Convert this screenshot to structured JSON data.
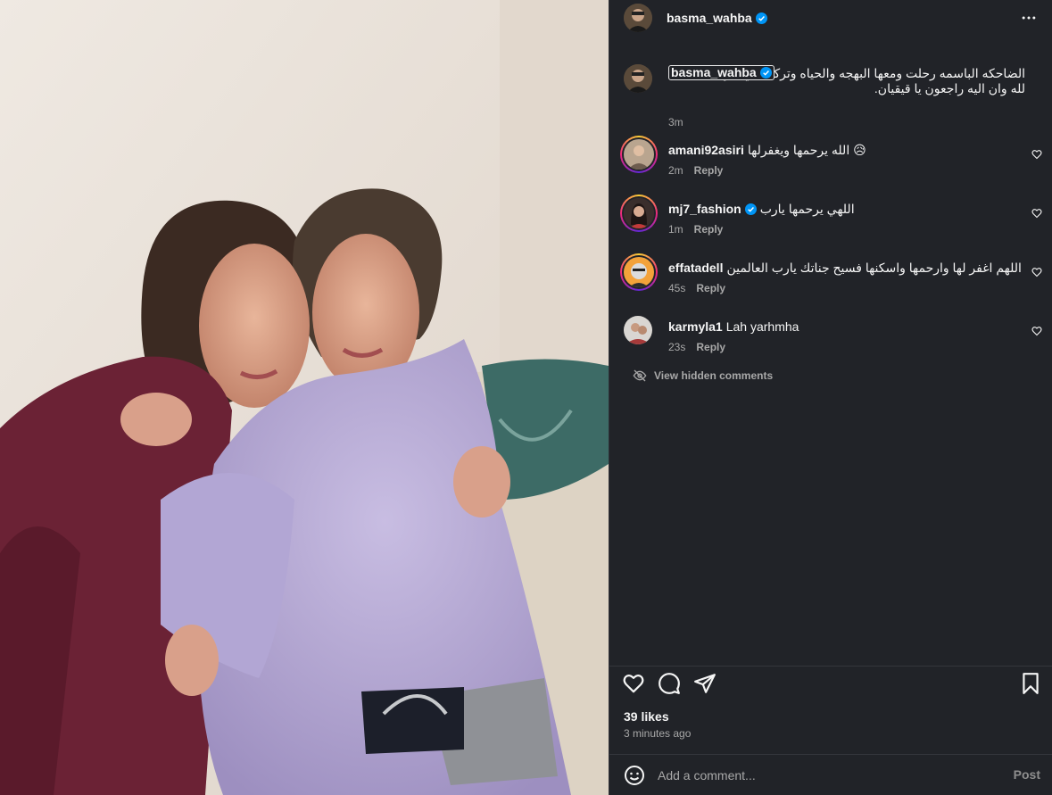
{
  "post": {
    "username": "basma_wahba",
    "verified": true,
    "photo_alt": "Two women hugging on a sofa"
  },
  "caption": {
    "username": "basma_wahba",
    "text": "الضاحكه الباسمه رحلت ومعها البهجه والحياه وتركتنا في دار الشقاء ان لله وان اليه راجعون يا قيقيان.",
    "time": "3m"
  },
  "comments": [
    {
      "username": "amani92asiri",
      "verified": false,
      "text": "الله يرحمها ويغفرلها 😥",
      "time": "2m",
      "reply": "Reply",
      "story_ring": true
    },
    {
      "username": "mj7_fashion",
      "verified": true,
      "text": "اللهي يرحمها يارب",
      "time": "1m",
      "reply": "Reply",
      "story_ring": true
    },
    {
      "username": "effatadell",
      "verified": false,
      "text": "اللهم اغفر لها وارحمها واسكنها فسيح جناتك يارب العالمين",
      "time": "45s",
      "reply": "Reply",
      "story_ring": true
    },
    {
      "username": "karmyla1",
      "verified": false,
      "text": "Lah yarhmha",
      "time": "23s",
      "reply": "Reply",
      "story_ring": false
    }
  ],
  "hidden_comments_label": "View hidden comments",
  "likes": "39 likes",
  "posted_time": "3 minutes ago",
  "add_comment": {
    "placeholder": "Add a comment...",
    "post_label": "Post"
  },
  "icons": {
    "more": "more-horizontal-icon",
    "like": "heart-icon",
    "comment": "comment-bubble-icon",
    "share": "paper-plane-icon",
    "save": "bookmark-icon",
    "emoji": "smiley-icon",
    "hidden": "eye-off-icon"
  },
  "colors": {
    "panel_bg": "#212328",
    "verified": "#0095f6",
    "muted": "#a8a8a8"
  }
}
